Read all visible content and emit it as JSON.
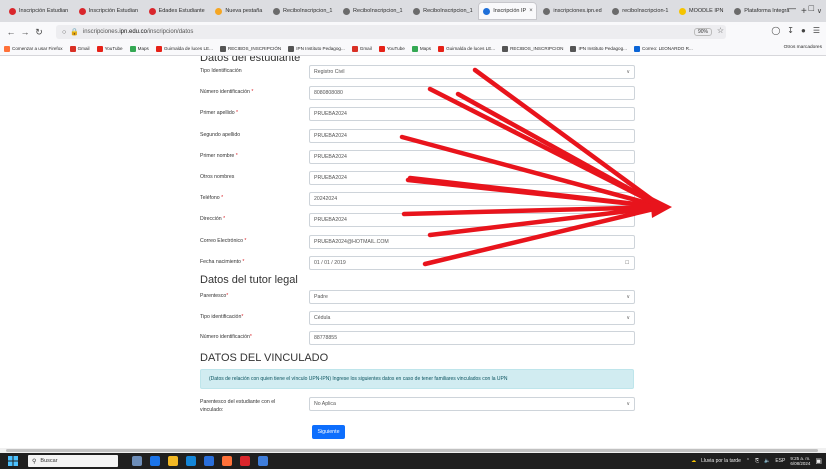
{
  "browser": {
    "tabs": [
      {
        "label": "Inscripción Estudian",
        "color": "#d9262c"
      },
      {
        "label": "Inscripción Estudian",
        "color": "#d9262c"
      },
      {
        "label": "Edades Estudiante",
        "color": "#d9262c"
      },
      {
        "label": "Nueva pestaña",
        "color": "#f5a623"
      },
      {
        "label": "ReciboInscripcion_1",
        "color": "#6b6b6b"
      },
      {
        "label": "ReciboInscripcion_1",
        "color": "#6b6b6b"
      },
      {
        "label": "ReciboInscripcion_1",
        "color": "#6b6b6b"
      },
      {
        "label": "Inscripción IP",
        "color": "#1e6fd9",
        "active": true
      },
      {
        "label": "inscripciones.ipn.ed",
        "color": "#6b6b6b"
      },
      {
        "label": "reciboInscripcion-1",
        "color": "#6b6b6b"
      },
      {
        "label": "MOODLE IPN",
        "color": "#f5c400"
      },
      {
        "label": "Plataforma Integra",
        "color": "#6b6b6b"
      }
    ],
    "url_prefix": "inscripciones.",
    "url_domain": "ipn.edu.co",
    "url_path": "/inscripcion/datos",
    "zoom": "90%",
    "bookmarks": [
      {
        "label": "Comenzar a usar Firefox",
        "color": "#ff7139"
      },
      {
        "label": "Gmail",
        "color": "#d93025"
      },
      {
        "label": "YouTube",
        "color": "#e62117"
      },
      {
        "label": "Maps",
        "color": "#34a853"
      },
      {
        "label": "Guirnalda de luces LE...",
        "color": "#e62117"
      },
      {
        "label": "RECIBOS_INSCRIPCIÓN",
        "color": "#555555"
      },
      {
        "label": "IPN Instituto Pedagog...",
        "color": "#555555"
      },
      {
        "label": "Gmail",
        "color": "#d93025"
      },
      {
        "label": "YouTube",
        "color": "#e62117"
      },
      {
        "label": "Maps",
        "color": "#34a853"
      },
      {
        "label": "Guirnalda de luces LE...",
        "color": "#e62117"
      },
      {
        "label": "RECIBOS_INSCRIPCION",
        "color": "#555555"
      },
      {
        "label": "IPN Instituto Pedagog...",
        "color": "#555555"
      },
      {
        "label": "Correo: LEONARDO R...",
        "color": "#0a64d6"
      }
    ],
    "other_bookmarks": "Otros marcadores"
  },
  "form": {
    "student_title": "Datos del estudiante",
    "student_fields": [
      {
        "label": "Tipo Identificación",
        "req": "",
        "value": "Registro Civil",
        "kind": "select"
      },
      {
        "label": "Número identificación",
        "req": " *",
        "value": "8080808080",
        "kind": "text"
      },
      {
        "label": "Primer apellido",
        "req": " *",
        "value": "PRUEBA2024",
        "kind": "text"
      },
      {
        "label": "Segundo apellido",
        "req": "",
        "value": "PRUEBA2024",
        "kind": "text"
      },
      {
        "label": "Primer nombre",
        "req": " *",
        "value": "PRUEBA2024",
        "kind": "text"
      },
      {
        "label": "Otros nombres",
        "req": "",
        "value": "PRUEBA2024",
        "kind": "text"
      },
      {
        "label": "Teléfono",
        "req": " *",
        "value": "20242024",
        "kind": "text"
      },
      {
        "label": "Dirección",
        "req": " *",
        "value": "PRUEBA2024",
        "kind": "text"
      },
      {
        "label": "Correo Electrónico",
        "req": " *",
        "value": "PRUEBA2024@HOTMAIL.COM",
        "kind": "text"
      },
      {
        "label": "Fecha nacimiento",
        "req": " *",
        "value": "01 / 01 / 2019",
        "kind": "date"
      }
    ],
    "tutor_title": "Datos del tutor legal",
    "tutor_fields": [
      {
        "label": "Parentesco",
        "req": "*",
        "value": "Padre",
        "kind": "select"
      },
      {
        "label": "Tipo identificación",
        "req": "*",
        "value": "Cédula",
        "kind": "select"
      },
      {
        "label": "Número identificación",
        "req": "*",
        "value": "88778855",
        "kind": "text"
      }
    ],
    "vinculado_title": "DATOS DEL VINCULADO",
    "vinculado_info": "(Datos de relación con quien tiene el vínculo UPN-IPN) Ingrese los siguientes datos en caso de tener familiares vinculados con la UPN",
    "vinculado_label_1": "Parentesco del estudiante con el",
    "vinculado_label_2": "vinculado:",
    "vinculado_value": "No Aplica",
    "next_label": "Siguiente"
  },
  "annotation": {
    "color": "#e8141c"
  },
  "taskbar": {
    "search_placeholder": "Buscar",
    "weather": "Lluvia por la tarde",
    "lang": "ESP",
    "time": "9:25 a. m.",
    "date": "6/08/2024",
    "icons": [
      {
        "name": "landscape-app-icon",
        "color": "#6d8db8"
      },
      {
        "name": "chrome-icon",
        "color": "#1a73e8"
      },
      {
        "name": "file-explorer-icon",
        "color": "#f2b824"
      },
      {
        "name": "edge-icon",
        "color": "#1486d8"
      },
      {
        "name": "store-icon",
        "color": "#2a6fdb"
      },
      {
        "name": "firefox-icon",
        "color": "#ff7139"
      },
      {
        "name": "app-red-icon",
        "color": "#d9262c"
      },
      {
        "name": "app-blue-icon",
        "color": "#3f7dd9"
      }
    ]
  }
}
